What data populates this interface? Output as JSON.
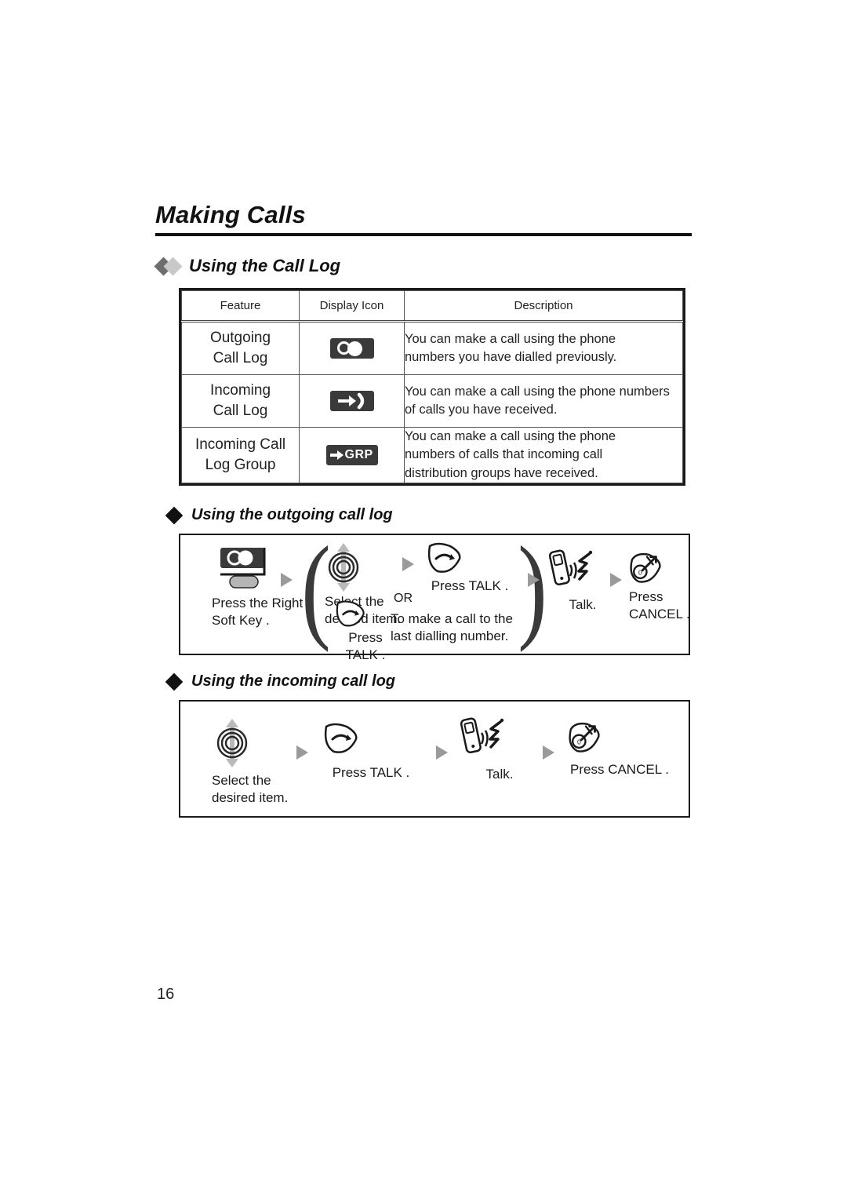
{
  "page": {
    "chapter_title": "Making Calls",
    "page_number": "16"
  },
  "section": {
    "heading": "Using the Call Log",
    "bullet_colors": [
      "#6e6e6e",
      "#c9c9c9"
    ]
  },
  "table": {
    "headers": [
      "Feature",
      "Display Icon",
      "Description"
    ],
    "rows": [
      {
        "feature": "Outgoing\nCall Log",
        "feature_line1": "Outgoing",
        "feature_line2": "Call Log",
        "icon": "outgoing-call-log-icon",
        "description": "You can make a call using the phone numbers you have dialled previously.",
        "desc_line1": "You can make a call using the phone",
        "desc_line2": "numbers you have dialled previously."
      },
      {
        "feature": "Incoming\nCall Log",
        "feature_line1": "Incoming",
        "feature_line2": "Call Log",
        "icon": "incoming-call-log-icon",
        "description": "You can make a call using the phone numbers of calls you have received.",
        "desc_line1": "You can make a call using the phone numbers",
        "desc_line2": "of calls you have received."
      },
      {
        "feature": "Incoming Call\nLog Group",
        "feature_line1": "Incoming Call",
        "feature_line2": "Log Group",
        "icon": "incoming-call-log-group-icon",
        "icon_text": "GRP",
        "description": "You can make a call using the phone numbers of calls that incoming call distribution groups have received.",
        "desc_line1": "You can make a call using the phone",
        "desc_line2": "numbers of calls that incoming call",
        "desc_line3": "distribution groups have received."
      }
    ]
  },
  "outgoing_flow": {
    "heading": "Using the outgoing call log",
    "step1": {
      "icon": "right-soft-key-icon",
      "caption_line1": "Press the Right",
      "caption_line2": "Soft Key ."
    },
    "step2a": {
      "icon": "navigator-up-down-icon",
      "caption_line1": "Select the",
      "caption_line2": "desired item."
    },
    "step2b": {
      "icon": "talk-key-icon",
      "caption": "Press TALK ."
    },
    "step2c": {
      "icon": "talk-key-icon",
      "caption_line1": "Press",
      "caption_line2": "TALK ."
    },
    "or_label": "OR",
    "step2d": {
      "caption_line1": "To make a call to the",
      "caption_line2": "last dialling number."
    },
    "step3": {
      "icon": "talking-handset-icon",
      "caption": "Talk."
    },
    "step4": {
      "icon": "cancel-key-icon",
      "caption_line1": "Press",
      "caption_line2": "CANCEL ."
    }
  },
  "incoming_flow": {
    "heading": "Using the incoming call log",
    "steps": [
      {
        "icon": "navigator-up-down-icon",
        "caption_line1": "Select the",
        "caption_line2": "desired item."
      },
      {
        "icon": "talk-key-icon",
        "caption_line1": "Press TALK .",
        "caption_line2": ""
      },
      {
        "icon": "talking-handset-icon",
        "caption_line1": "Talk.",
        "caption_line2": ""
      },
      {
        "icon": "cancel-key-icon",
        "caption_line1": "Press CANCEL .",
        "caption_line2": ""
      }
    ]
  },
  "colors": {
    "ink": "#1a1a1a",
    "icon_bg": "#3a3a3a",
    "arrow_gray": "#9a9a9a",
    "diamond_dark": "#6e6e6e",
    "diamond_light": "#c9c9c9"
  }
}
